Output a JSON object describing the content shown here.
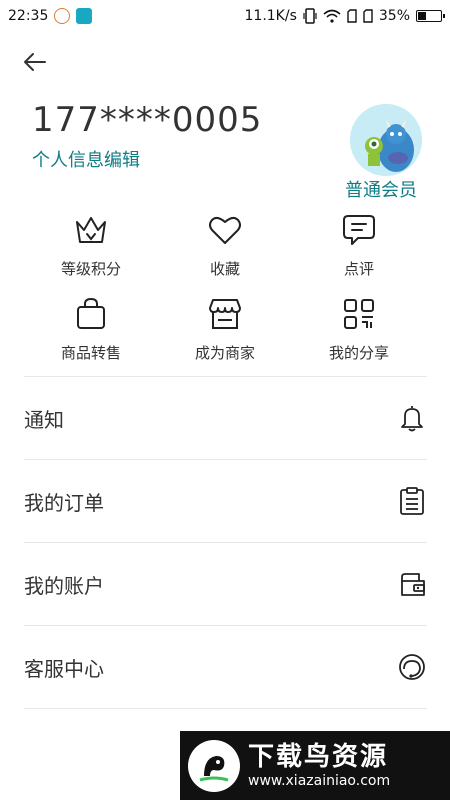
{
  "status_bar": {
    "time": "22:35",
    "net_speed": "11.1K/s",
    "battery_text": "35%",
    "battery_level": 0.35
  },
  "profile": {
    "phone": "177****0005",
    "edit_label": "个人信息编辑",
    "member_level": "普通会员"
  },
  "grid": {
    "row1": [
      {
        "label": "等级积分",
        "icon": "crown-icon"
      },
      {
        "label": "收藏",
        "icon": "heart-icon"
      },
      {
        "label": "点评",
        "icon": "comment-icon"
      }
    ],
    "row2": [
      {
        "label": "商品转售",
        "icon": "bag-icon"
      },
      {
        "label": "成为商家",
        "icon": "store-icon"
      },
      {
        "label": "我的分享",
        "icon": "qr-icon"
      }
    ]
  },
  "menu": [
    {
      "label": "通知",
      "icon": "bell-icon"
    },
    {
      "label": "我的订单",
      "icon": "clipboard-icon"
    },
    {
      "label": "我的账户",
      "icon": "wallet-icon"
    },
    {
      "label": "客服中心",
      "icon": "headset-icon"
    }
  ],
  "watermark": {
    "title": "下载鸟资源",
    "url": "www.xiazainiao.com"
  },
  "colors": {
    "accent": "#0f7d86",
    "divider": "#e8e8e8",
    "text": "#333333"
  }
}
